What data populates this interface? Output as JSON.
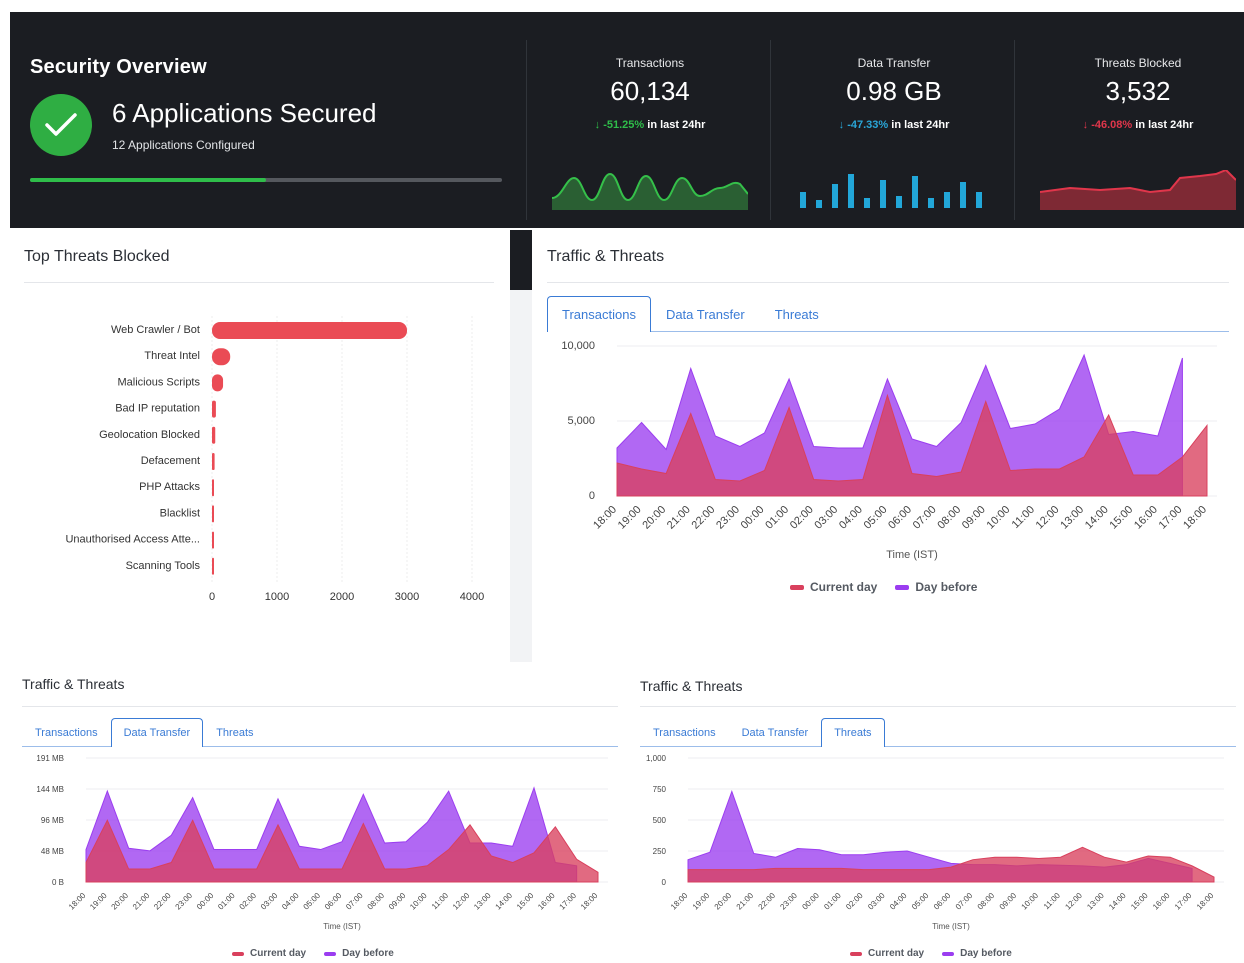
{
  "overview": {
    "title": "Security Overview",
    "secured": "6 Applications Secured",
    "configured": "12 Applications Configured",
    "progress": 0.5,
    "color": "#2fae43"
  },
  "stats": [
    {
      "label": "Transactions",
      "value": "60,134",
      "arrow": "↓",
      "change": "-51.25%",
      "suffix": "in last 24hr",
      "color": "#2fbd4a"
    },
    {
      "label": "Data Transfer",
      "value": "0.98 GB",
      "arrow": "↓",
      "change": "-47.33%",
      "suffix": "in last 24hr",
      "color": "#2aa6d8"
    },
    {
      "label": "Threats Blocked",
      "value": "3,532",
      "arrow": "↓",
      "change": "-46.08%",
      "suffix": "in last 24hr",
      "color": "#e0364b"
    }
  ],
  "top_threats": {
    "title": "Top Threats Blocked",
    "color": "#ea4b55"
  },
  "traffic_panels": [
    {
      "title": "Traffic & Threats",
      "tabs": [
        "Transactions",
        "Data Transfer",
        "Threats"
      ],
      "active": 0
    },
    {
      "title": "Traffic & Threats",
      "tabs": [
        "Transactions",
        "Data Transfer",
        "Threats"
      ],
      "active": 1
    },
    {
      "title": "Traffic & Threats",
      "tabs": [
        "Transactions",
        "Data Transfer",
        "Threats"
      ],
      "active": 2
    }
  ],
  "legend": {
    "current": "Current day",
    "before": "Day before",
    "current_color": "#d9405d",
    "before_color": "#9b3df0"
  },
  "chart_data": [
    {
      "type": "bar",
      "orientation": "horizontal",
      "title": "Top Threats Blocked",
      "categories": [
        "Web Crawler / Bot",
        "Threat Intel",
        "Malicious Scripts",
        "Bad IP reputation",
        "Geolocation Blocked",
        "Defacement",
        "PHP Attacks",
        "Blacklist",
        "Unauthorised Access Atte...",
        "Scanning Tools"
      ],
      "values": [
        3000,
        280,
        170,
        60,
        50,
        40,
        20,
        10,
        8,
        5
      ],
      "xlim": [
        0,
        4000
      ],
      "xticks": [
        "0",
        "1000",
        "2000",
        "3000",
        "4000"
      ]
    },
    {
      "type": "area",
      "title": "Traffic & Threats",
      "tab": "Transactions",
      "xlabel": "Time (IST)",
      "ylim": [
        0,
        10000
      ],
      "yticks": [
        "0",
        "5,000",
        "10,000"
      ],
      "x": [
        "18:00",
        "19:00",
        "20:00",
        "21:00",
        "22:00",
        "23:00",
        "00:00",
        "01:00",
        "02:00",
        "03:00",
        "04:00",
        "05:00",
        "06:00",
        "07:00",
        "08:00",
        "09:00",
        "10:00",
        "11:00",
        "12:00",
        "13:00",
        "14:00",
        "15:00",
        "16:00",
        "17:00",
        "18:00"
      ],
      "series": [
        {
          "name": "Day before",
          "values": [
            3200,
            4900,
            3100,
            8500,
            4000,
            3300,
            4200,
            7800,
            3300,
            3200,
            3200,
            7800,
            3800,
            3300,
            4900,
            8700,
            4500,
            4800,
            5800,
            9400,
            4100,
            4300,
            4000,
            9200,
            null
          ]
        },
        {
          "name": "Current day",
          "values": [
            2200,
            1800,
            1500,
            5500,
            1100,
            1000,
            1700,
            5900,
            1100,
            1000,
            1100,
            6700,
            1500,
            1300,
            1600,
            6300,
            1700,
            1800,
            1800,
            2600,
            5400,
            1400,
            1400,
            2600,
            4700
          ]
        }
      ]
    },
    {
      "type": "area",
      "title": "Traffic & Threats",
      "tab": "Data Transfer",
      "xlabel": "Time (IST)",
      "ylim": [
        0,
        191
      ],
      "yticks": [
        "0 B",
        "48 MB",
        "96 MB",
        "144 MB",
        "191 MB"
      ],
      "x": [
        "18:00",
        "19:00",
        "20:00",
        "21:00",
        "22:00",
        "23:00",
        "00:00",
        "01:00",
        "02:00",
        "03:00",
        "04:00",
        "05:00",
        "06:00",
        "07:00",
        "08:00",
        "09:00",
        "10:00",
        "11:00",
        "12:00",
        "13:00",
        "14:00",
        "15:00",
        "16:00",
        "17:00",
        "18:00"
      ],
      "series": [
        {
          "name": "Day before",
          "values": [
            50,
            140,
            52,
            48,
            72,
            130,
            50,
            50,
            50,
            128,
            55,
            50,
            62,
            135,
            60,
            62,
            92,
            140,
            60,
            60,
            55,
            145,
            30,
            25,
            null
          ]
        },
        {
          "name": "Current day",
          "values": [
            30,
            95,
            20,
            20,
            30,
            95,
            20,
            20,
            20,
            88,
            20,
            20,
            20,
            90,
            20,
            20,
            25,
            50,
            88,
            40,
            30,
            45,
            85,
            35,
            15
          ]
        }
      ]
    },
    {
      "type": "area",
      "title": "Traffic & Threats",
      "tab": "Threats",
      "xlabel": "Time (IST)",
      "ylim": [
        0,
        1000
      ],
      "yticks": [
        "0",
        "250",
        "500",
        "750",
        "1,000"
      ],
      "x": [
        "18:00",
        "19:00",
        "20:00",
        "21:00",
        "22:00",
        "23:00",
        "00:00",
        "01:00",
        "02:00",
        "03:00",
        "04:00",
        "05:00",
        "06:00",
        "07:00",
        "08:00",
        "09:00",
        "10:00",
        "11:00",
        "12:00",
        "13:00",
        "14:00",
        "15:00",
        "16:00",
        "17:00",
        "18:00"
      ],
      "series": [
        {
          "name": "Day before",
          "values": [
            180,
            240,
            730,
            230,
            200,
            270,
            260,
            220,
            220,
            240,
            250,
            200,
            150,
            140,
            140,
            130,
            140,
            135,
            130,
            120,
            140,
            190,
            150,
            110,
            null
          ]
        },
        {
          "name": "Current day",
          "values": [
            100,
            100,
            100,
            100,
            110,
            110,
            110,
            110,
            100,
            100,
            100,
            100,
            120,
            180,
            200,
            200,
            190,
            200,
            280,
            200,
            160,
            210,
            200,
            130,
            40
          ]
        }
      ]
    }
  ]
}
